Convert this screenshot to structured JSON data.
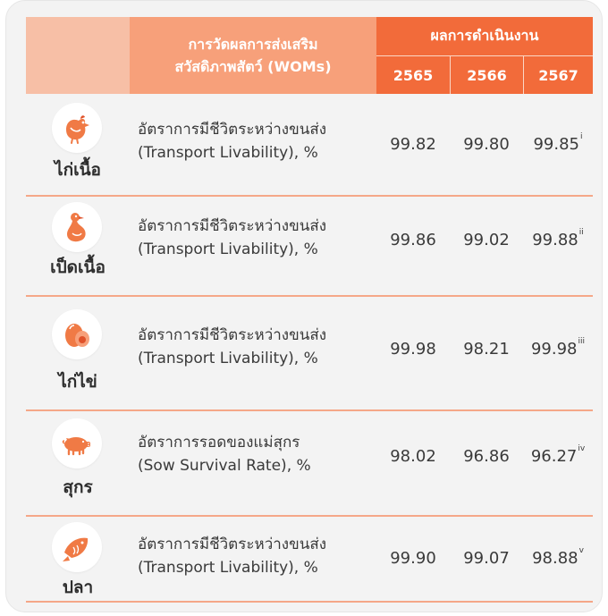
{
  "header": {
    "metric_line1": "การวัดผลการส่งเสริม",
    "metric_line2": "สวัสดิภาพสัตว์ (WOMs)",
    "performance": "ผลการดำเนินงาน",
    "years": [
      "2565",
      "2566",
      "2567"
    ]
  },
  "rows": [
    {
      "animal": "ไก่เนื้อ",
      "icon": "chicken-icon",
      "metric_line1": "อัตราการมีชีวิตระหว่างขนส่ง",
      "metric_line2": "(Transport Livability), %",
      "values": [
        "99.82",
        "99.80",
        "99.85"
      ],
      "note": "i"
    },
    {
      "animal": "เป็ดเนื้อ",
      "icon": "duck-icon",
      "metric_line1": "อัตราการมีชีวิตระหว่างขนส่ง",
      "metric_line2": "(Transport Livability), %",
      "values": [
        "99.86",
        "99.02",
        "99.88"
      ],
      "note": "ii"
    },
    {
      "animal": "ไก่ไข่",
      "icon": "egg-icon",
      "metric_line1": "อัตราการมีชีวิตระหว่างขนส่ง",
      "metric_line2": "(Transport Livability), %",
      "values": [
        "99.98",
        "98.21",
        "99.98"
      ],
      "note": "iii"
    },
    {
      "animal": "สุกร",
      "icon": "pig-icon",
      "metric_line1": "อัตราการรอดของแม่สุกร",
      "metric_line2": "(Sow Survival Rate), %",
      "values": [
        "98.02",
        "96.86",
        "96.27"
      ],
      "note": "iv"
    },
    {
      "animal": "ปลา",
      "icon": "fish-icon",
      "metric_line1": "อัตราการมีชีวิตระหว่างขนส่ง",
      "metric_line2": "(Transport Livability), %",
      "values": [
        "99.90",
        "99.07",
        "98.88"
      ],
      "note": "v"
    }
  ],
  "colors": {
    "header_dark": "#f26b3a",
    "header_mid": "#f7a07a",
    "header_light": "#f7bfa6",
    "divider": "#f5a788",
    "icon_orange": "#f07a45"
  }
}
